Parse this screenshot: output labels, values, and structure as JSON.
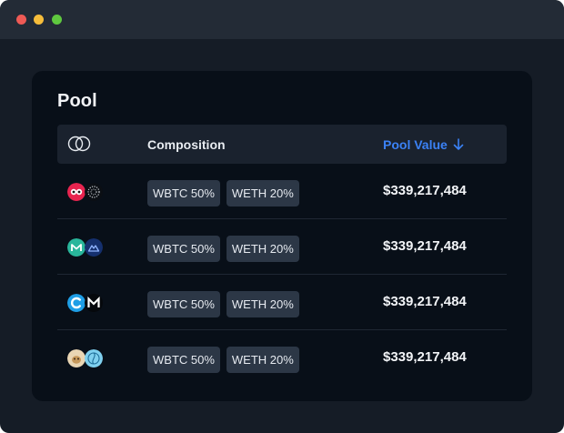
{
  "window": {
    "controls": [
      "close",
      "minimize",
      "zoom"
    ]
  },
  "pool": {
    "title": "Pool",
    "header": {
      "icon": "pool-rings-icon",
      "composition_label": "Composition",
      "pool_value_label": "Pool Value",
      "sort_icon": "arrow-down-icon"
    },
    "rows": [
      {
        "token_icons": [
          "red-owl-token-icon",
          "dotted-token-icon"
        ],
        "composition": [
          "WBTC 50%",
          "WETH 20%"
        ],
        "value": "$339,217,484"
      },
      {
        "token_icons": [
          "teal-m-token-icon",
          "navy-triangle-token-icon"
        ],
        "composition": [
          "WBTC 50%",
          "WETH 20%"
        ],
        "value": "$339,217,484"
      },
      {
        "token_icons": [
          "blue-c-token-icon",
          "black-m-token-icon"
        ],
        "composition": [
          "WBTC 50%",
          "WETH 20%"
        ],
        "value": "$339,217,484"
      },
      {
        "token_icons": [
          "beige-animal-token-icon",
          "sky-swirl-token-icon"
        ],
        "composition": [
          "WBTC 50%",
          "WETH 20%"
        ],
        "value": "$339,217,484"
      }
    ]
  },
  "colors": {
    "accent": "#3b82f6",
    "card_background": "#080f18",
    "window_background": "#151c26"
  }
}
